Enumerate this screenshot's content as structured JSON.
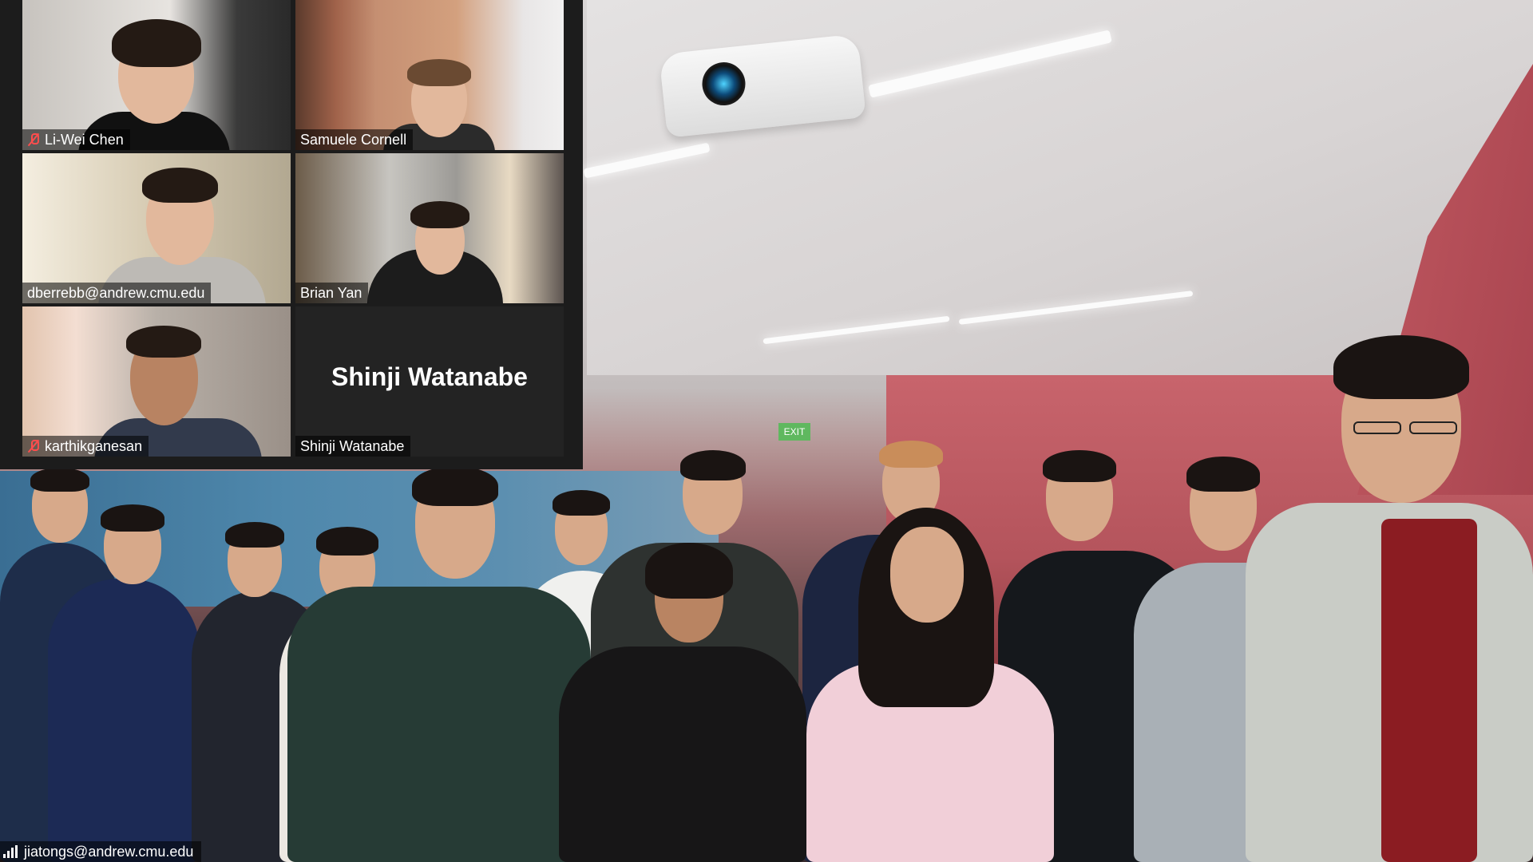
{
  "main_video": {
    "participant_label": "jiatongs@andrew.cmu.edu",
    "icon": "signal-strength-icon"
  },
  "gallery": {
    "tiles": [
      {
        "name": "Li-Wei Chen",
        "muted": true,
        "icon": "mic-muted-icon"
      },
      {
        "name": "Samuele Cornell",
        "muted": false
      },
      {
        "name": "dberrebb@andrew.cmu.edu",
        "muted": false
      },
      {
        "name": "Brian Yan",
        "muted": false
      },
      {
        "name": "karthikganesan",
        "muted": true,
        "icon": "mic-muted-icon"
      },
      {
        "name": "Shinji Watanabe",
        "muted": false,
        "video_off": true,
        "display_name": "Shinji Watanabe"
      }
    ]
  },
  "exit_sign": "EXIT",
  "colors": {
    "mute_red": "#ff4d4d",
    "name_tag_bg": "rgba(0,0,0,0.55)",
    "gallery_bg": "#1c1c1c",
    "wall_red": "#b4545c"
  }
}
